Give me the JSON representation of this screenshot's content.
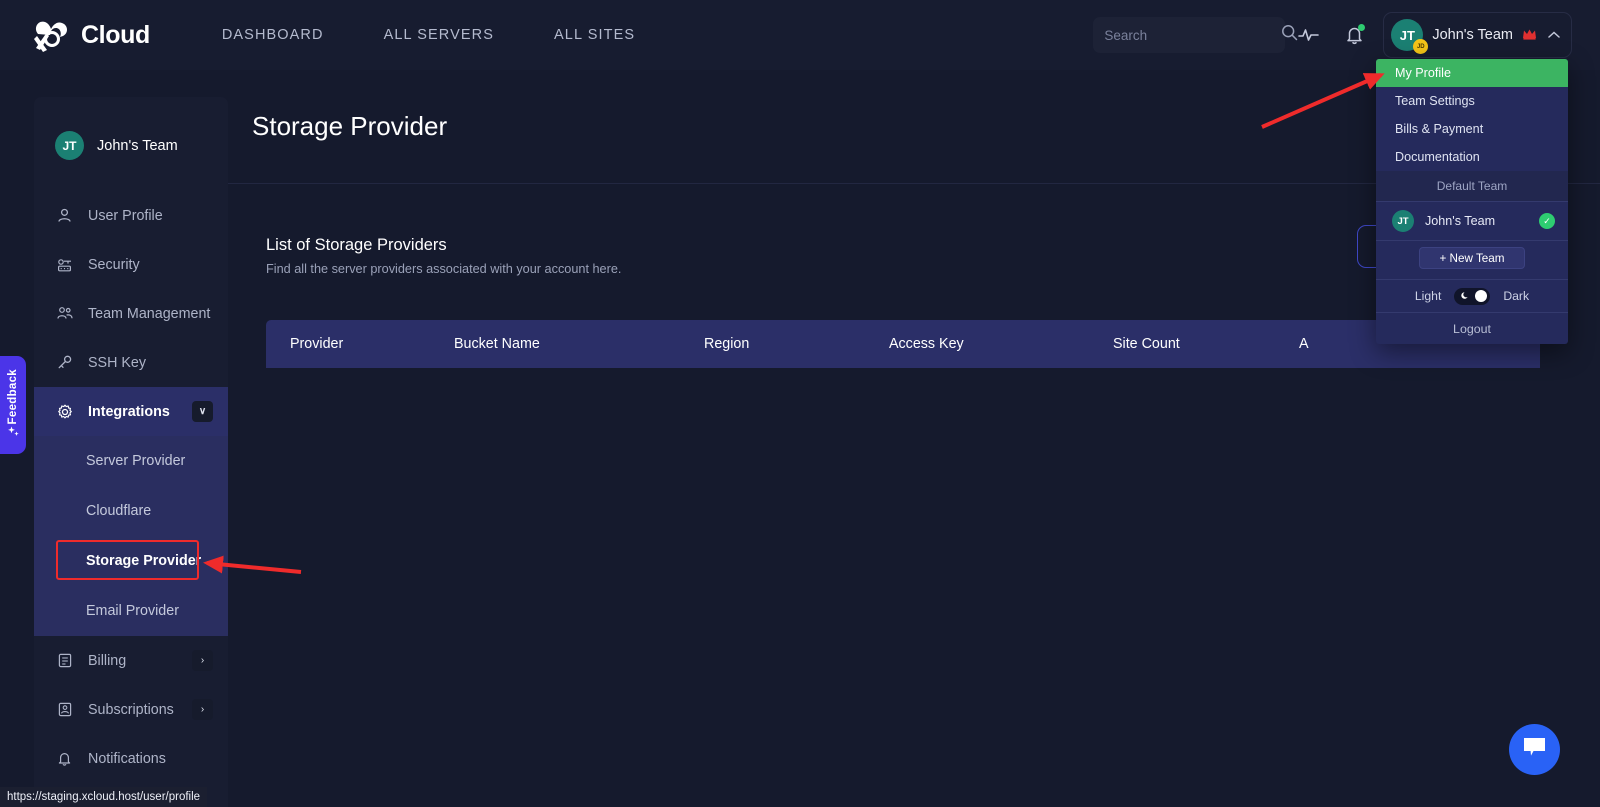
{
  "topnav": {
    "brand": "Cloud",
    "brand_icon": "xcloud-logo-icon",
    "links": [
      {
        "label": "DASHBOARD"
      },
      {
        "label": "ALL SERVERS"
      },
      {
        "label": "ALL SITES"
      }
    ],
    "search": {
      "placeholder": "Search",
      "value": "",
      "icon": "search-icon"
    },
    "activity_icon": "activity-pulse-icon",
    "notification_icon": "bell-icon",
    "user": {
      "initials": "JT",
      "badge": "JD",
      "name": "John's Team",
      "crown": "♛",
      "caret": "⌃"
    }
  },
  "sidebar": {
    "team": {
      "initials": "JT",
      "name": "John's Team"
    },
    "items": [
      {
        "label": "User Profile",
        "icon": "user-icon"
      },
      {
        "label": "Security",
        "icon": "security-icon"
      },
      {
        "label": "Team Management",
        "icon": "team-icon"
      },
      {
        "label": "SSH Key",
        "icon": "key-icon"
      },
      {
        "label": "Integrations",
        "icon": "gear-icon",
        "expanded": true,
        "chevron": "∨"
      },
      {
        "label": "Billing",
        "icon": "billing-icon",
        "chevron": "›"
      },
      {
        "label": "Subscriptions",
        "icon": "subscriptions-icon",
        "chevron": "›"
      },
      {
        "label": "Notifications",
        "icon": "bell-icon"
      }
    ],
    "submenu": [
      {
        "label": "Server Provider"
      },
      {
        "label": "Cloudflare"
      },
      {
        "label": "Storage Provider",
        "selected": true
      },
      {
        "label": "Email Provider"
      }
    ]
  },
  "feedback": {
    "label": "Feedback",
    "icon": "sparkle-icon"
  },
  "main": {
    "page_title": "Storage Provider",
    "list_title": "List of Storage Providers",
    "list_subtitle": "Find all the server providers associated with your account here.",
    "table": {
      "columns": [
        "Provider",
        "Bucket Name",
        "Region",
        "Access Key",
        "Site Count",
        "A"
      ],
      "rows": []
    }
  },
  "dropdown": {
    "items": [
      {
        "label": "My Profile",
        "highlighted": true
      },
      {
        "label": "Team Settings"
      },
      {
        "label": "Bills & Payment"
      },
      {
        "label": "Documentation"
      }
    ],
    "section_label": "Default Team",
    "team": {
      "initials": "JT",
      "name": "John's Team",
      "check": "✓"
    },
    "new_team_label": "+ New Team",
    "theme": {
      "light": "Light",
      "dark": "Dark",
      "mode": "dark",
      "moon_icon": "moon-icon"
    },
    "logout_label": "Logout"
  },
  "chat": {
    "icon": "chat-bubble-icon"
  },
  "statusbar": {
    "url": "https://staging.xcloud.host/user/profile"
  },
  "annotations": {
    "arrow_menu": "red-arrow-pointing-to-my-profile",
    "arrow_sidebar": "red-arrow-pointing-to-storage-provider",
    "highlight_box": "red-box-around-storage-provider"
  },
  "colors": {
    "accent_green": "#3cb462",
    "nav_bg": "#171c30",
    "page_bg": "#151a2d",
    "sidebar_bg": "#181d31",
    "active_blue": "#2b2f68",
    "annotation_red": "#ef2b2b",
    "feedback_purple": "#4b35e8",
    "chat_blue": "#2962f6",
    "avatar_teal": "#1b8073"
  }
}
